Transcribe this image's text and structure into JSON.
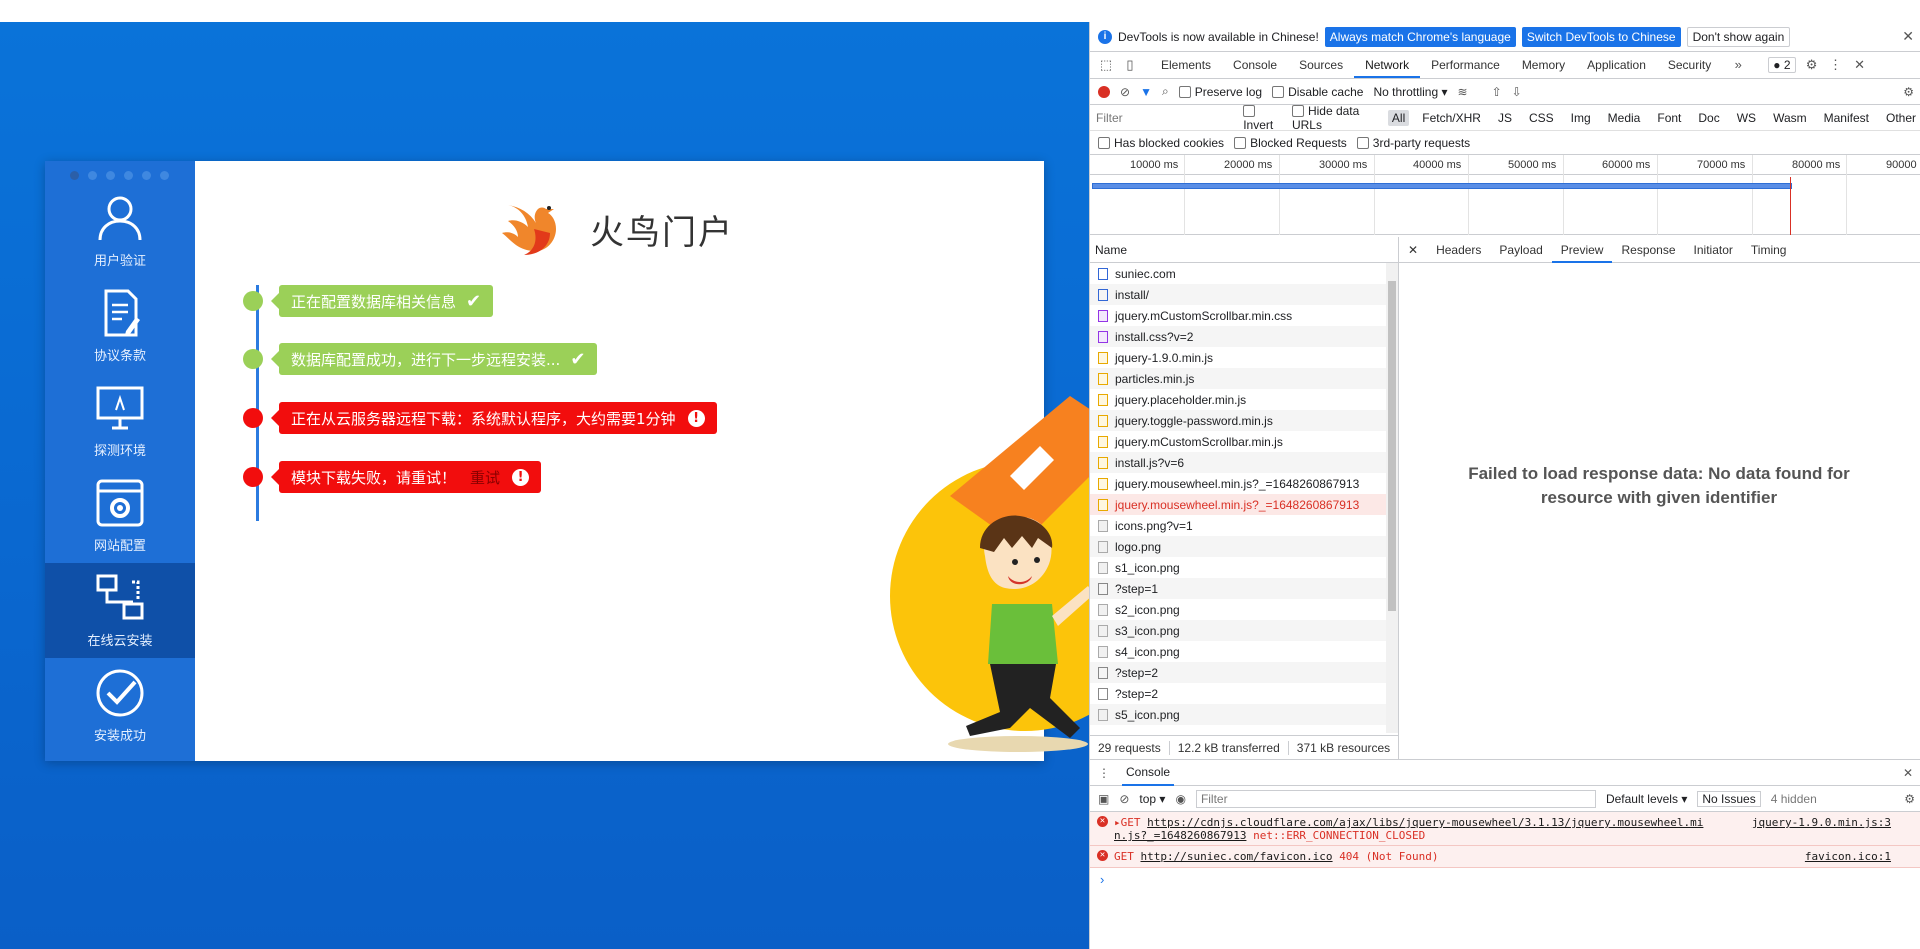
{
  "installer": {
    "brand": "火鸟门户",
    "sidebar": [
      {
        "label": "用户验证",
        "icon": "user-icon"
      },
      {
        "label": "协议条款",
        "icon": "document-icon"
      },
      {
        "label": "探测环境",
        "icon": "monitor-icon"
      },
      {
        "label": "网站配置",
        "icon": "settings-icon"
      },
      {
        "label": "在线云安装",
        "icon": "network-icon",
        "active": true
      },
      {
        "label": "安装成功",
        "icon": "check-circle-icon"
      }
    ],
    "steps": [
      {
        "text": "正在配置数据库相关信息",
        "status": "success"
      },
      {
        "text": "数据库配置成功，进行下一步远程安装...",
        "status": "success"
      },
      {
        "text": "正在从云服务器远程下载：系统默认程序，大约需要1分钟",
        "status": "error"
      },
      {
        "text": "模块下载失败，请重试！",
        "status": "error",
        "retry": "重试"
      }
    ],
    "colors": {
      "success": "#9bd058",
      "error": "#f20d0d",
      "sidebar": "#1e6fd6",
      "background": "#0a6ad2"
    }
  },
  "devtools": {
    "infobar": {
      "message": "DevTools is now available in Chinese!",
      "btn_match": "Always match Chrome's language",
      "btn_switch": "Switch DevTools to Chinese",
      "btn_dismiss": "Don't show again"
    },
    "tabs": [
      "Elements",
      "Console",
      "Sources",
      "Network",
      "Performance",
      "Memory",
      "Application",
      "Security"
    ],
    "active_tab": "Network",
    "issues_count": "2",
    "toolbar": {
      "preserve_log": "Preserve log",
      "disable_cache": "Disable cache",
      "throttling": "No throttling"
    },
    "filter": {
      "placeholder": "Filter",
      "invert": "Invert",
      "hide_data_urls": "Hide data URLs",
      "types": [
        "All",
        "Fetch/XHR",
        "JS",
        "CSS",
        "Img",
        "Media",
        "Font",
        "Doc",
        "WS",
        "Wasm",
        "Manifest",
        "Other"
      ],
      "has_blocked_cookies": "Has blocked cookies",
      "blocked_requests": "Blocked Requests",
      "third_party": "3rd-party requests"
    },
    "timeline_ticks": [
      "10000 ms",
      "20000 ms",
      "30000 ms",
      "40000 ms",
      "50000 ms",
      "60000 ms",
      "70000 ms",
      "80000 ms",
      "90000"
    ],
    "name_header": "Name",
    "requests": [
      {
        "name": "suniec.com",
        "type": "doc"
      },
      {
        "name": "install/",
        "type": "doc"
      },
      {
        "name": "jquery.mCustomScrollbar.min.css",
        "type": "css"
      },
      {
        "name": "install.css?v=2",
        "type": "css"
      },
      {
        "name": "jquery-1.9.0.min.js",
        "type": "js"
      },
      {
        "name": "particles.min.js",
        "type": "js"
      },
      {
        "name": "jquery.placeholder.min.js",
        "type": "js"
      },
      {
        "name": "jquery.toggle-password.min.js",
        "type": "js"
      },
      {
        "name": "jquery.mCustomScrollbar.min.js",
        "type": "js"
      },
      {
        "name": "install.js?v=6",
        "type": "js"
      },
      {
        "name": "jquery.mousewheel.min.js?_=1648260867913",
        "type": "js"
      },
      {
        "name": "jquery.mousewheel.min.js?_=1648260867913",
        "type": "js",
        "error": true
      },
      {
        "name": "icons.png?v=1",
        "type": "img"
      },
      {
        "name": "logo.png",
        "type": "img"
      },
      {
        "name": "s1_icon.png",
        "type": "img"
      },
      {
        "name": "?step=1",
        "type": "bl"
      },
      {
        "name": "s2_icon.png",
        "type": "img"
      },
      {
        "name": "s3_icon.png",
        "type": "img"
      },
      {
        "name": "s4_icon.png",
        "type": "img"
      },
      {
        "name": "?step=2",
        "type": "bl"
      },
      {
        "name": "?step=2",
        "type": "bl"
      },
      {
        "name": "s5_icon.png",
        "type": "img"
      }
    ],
    "summary": {
      "requests": "29 requests",
      "transferred": "12.2 kB transferred",
      "resources": "371 kB resources"
    },
    "detail_tabs": [
      "Headers",
      "Payload",
      "Preview",
      "Response",
      "Initiator",
      "Timing"
    ],
    "active_detail_tab": "Preview",
    "preview_message": "Failed to load response data: No data found for resource with given identifier",
    "console": {
      "title": "Console",
      "context": "top",
      "filter_placeholder": "Filter",
      "levels": "Default levels",
      "issues": "No Issues",
      "hidden": "4 hidden",
      "messages": [
        {
          "method": "GET",
          "url": "https://cdnjs.cloudflare.com/ajax/libs/jquery-mousewheel/3.1.13/jquery.mousewheel.min.js?_=1648260867913",
          "status": "net::ERR_CONNECTION_CLOSED",
          "source": "jquery-1.9.0.min.js:3"
        },
        {
          "method": "GET",
          "url": "http://suniec.com/favicon.ico",
          "status": "404 (Not Found)",
          "source": "favicon.ico:1"
        }
      ]
    }
  }
}
